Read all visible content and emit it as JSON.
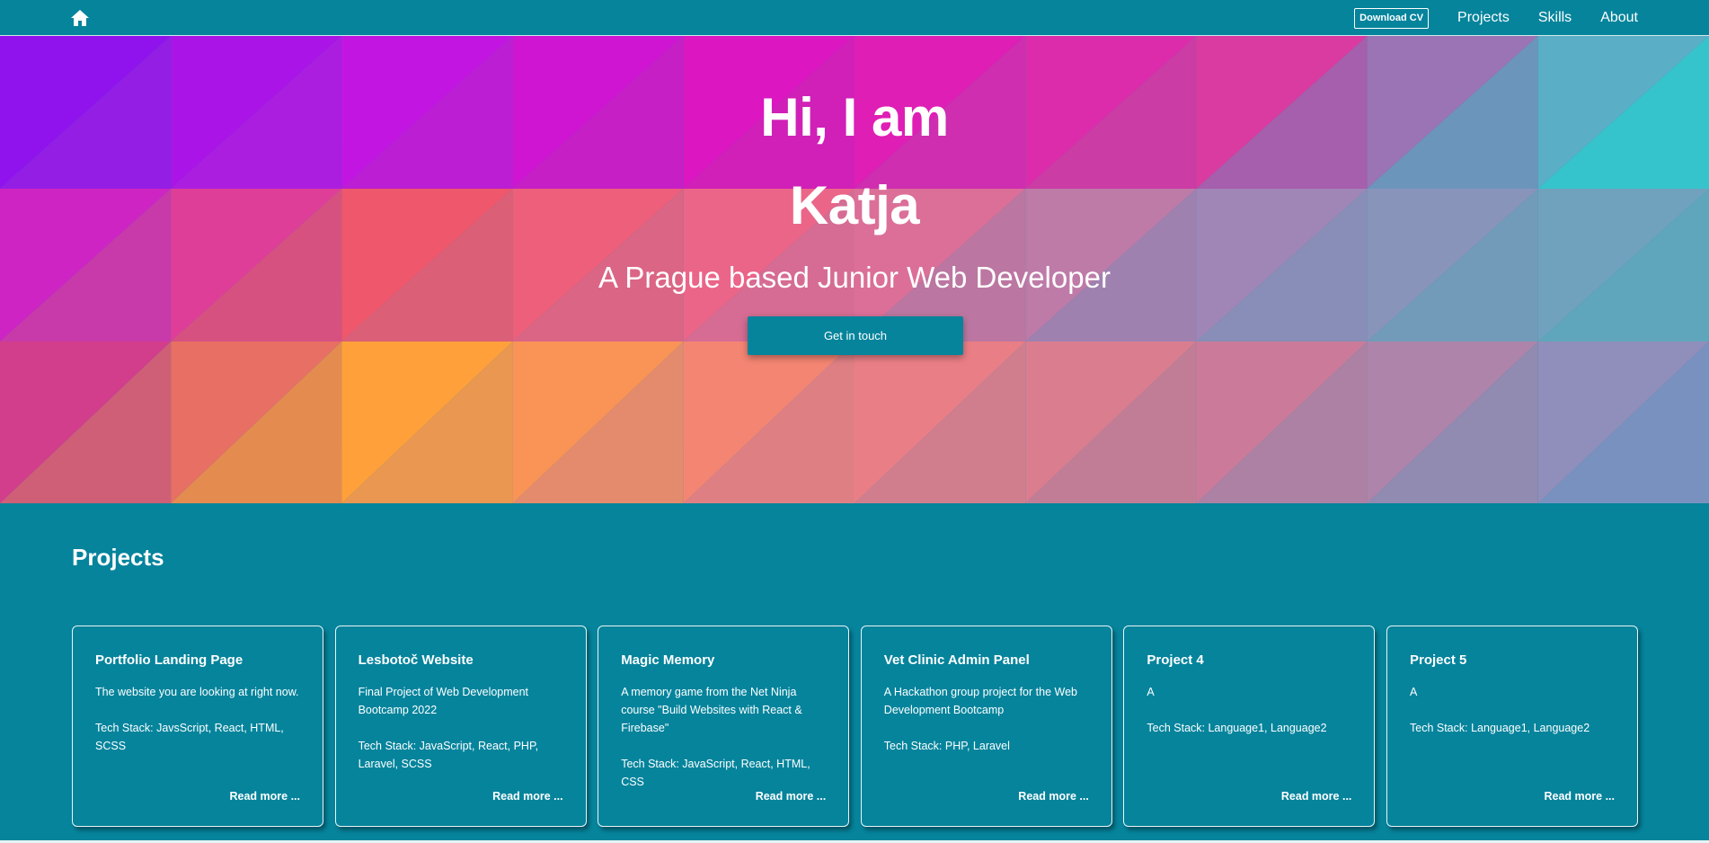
{
  "colors": {
    "primary": "#05849c",
    "text": "#ffffff"
  },
  "nav": {
    "home_icon": "home-icon",
    "download_cv": "Download CV",
    "links": [
      "Projects",
      "Skills",
      "About"
    ]
  },
  "hero": {
    "greeting": "Hi, I am",
    "name": "Katja",
    "subtitle": "A Prague based Junior Web Developer",
    "cta": "Get in touch"
  },
  "projects": {
    "title": "Projects",
    "cards": [
      {
        "title": "Portfolio Landing Page",
        "description": "The website you are looking at right now.",
        "tech": "Tech Stack: JavsScript, React, HTML, SCSS",
        "read_more": "Read more ..."
      },
      {
        "title": "Lesbotoč Website",
        "description": "Final Project of Web Development Bootcamp 2022",
        "tech": "Tech Stack: JavaScript, React, PHP, Laravel, SCSS",
        "read_more": "Read more ..."
      },
      {
        "title": "Magic Memory",
        "description": "A memory game from the Net Ninja course \"Build Websites with React & Firebase\"",
        "tech": "Tech Stack: JavaScript, React, HTML, CSS",
        "read_more": "Read more ..."
      },
      {
        "title": "Vet Clinic Admin Panel",
        "description": "A Hackathon group project for the Web Development Bootcamp",
        "tech": "Tech Stack: PHP, Laravel",
        "read_more": "Read more ..."
      },
      {
        "title": "Project 4",
        "description": "A",
        "tech": "Tech Stack: Language1, Language2",
        "read_more": "Read more ..."
      },
      {
        "title": "Project 5",
        "description": "A",
        "tech": "Tech Stack: Language1, Language2",
        "read_more": "Read more ..."
      }
    ]
  }
}
